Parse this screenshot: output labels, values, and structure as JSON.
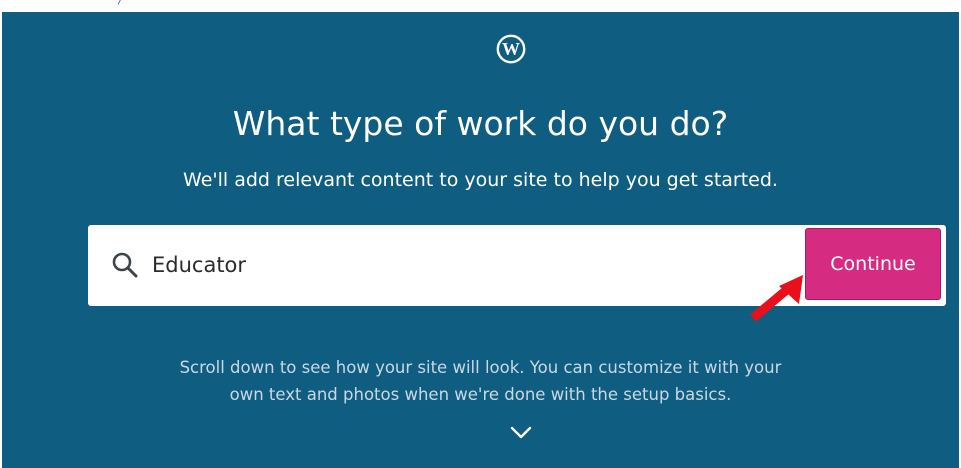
{
  "onboarding": {
    "title": "What type of work do you do?",
    "subtitle": "We'll add relevant content to your site to help you get started.",
    "search": {
      "value": "Educator",
      "icon": "search-icon"
    },
    "continue_label": "Continue",
    "hint_line1": "Scroll down to see how your site will look. You can customize it with your",
    "hint_line2": "own text and photos when we're done with the setup basics.",
    "scroll_icon": "chevron-down-icon"
  },
  "colors": {
    "background": "#0f5d80",
    "continue_button": "#d52c82",
    "annotation_arrow": "#e8101a",
    "top_fragment_text": "#1f4fd6"
  }
}
